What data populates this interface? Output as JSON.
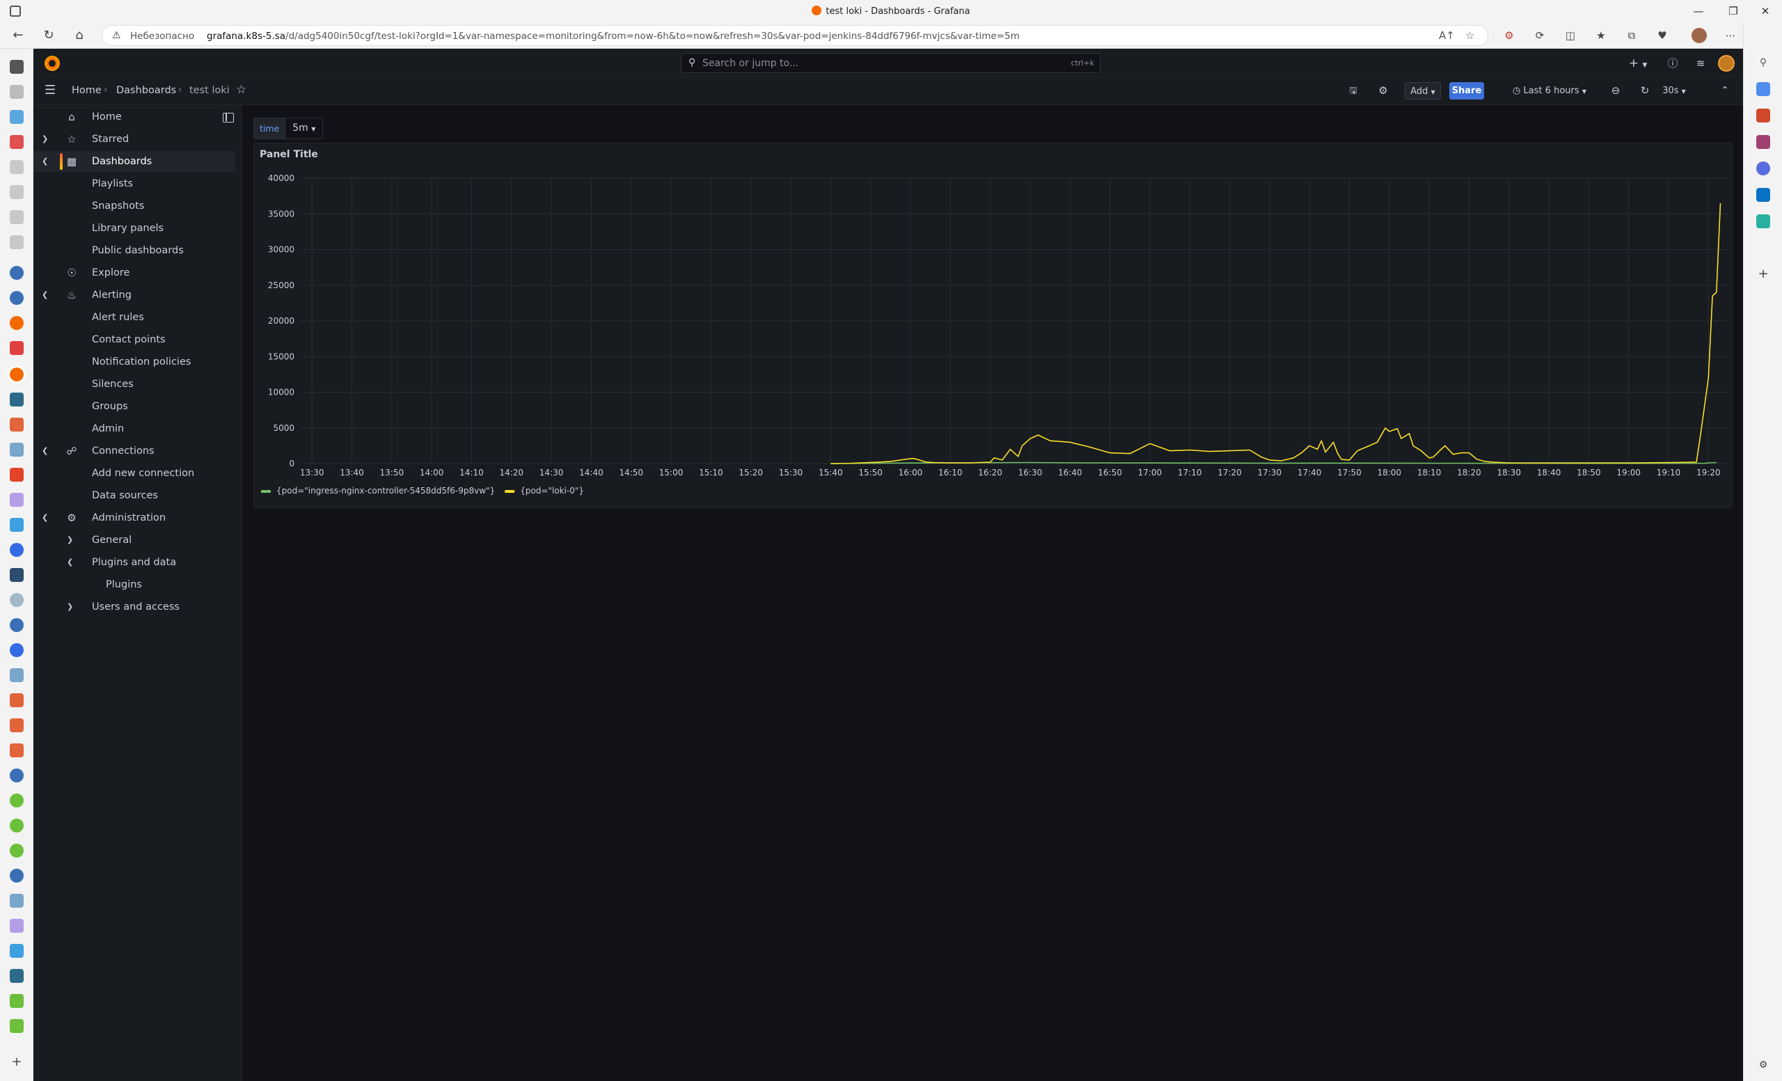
{
  "browser": {
    "window_title": "test loki - Dashboards - Grafana",
    "security_label": "Небезопасно",
    "url_host": "grafana.k8s-5.sa",
    "url_path": "/d/adg5400in50cgf/test-loki?orgId=1&var-namespace=monitoring&from=now-6h&to=now&refresh=30s&var-pod=jenkins-84ddf6796f-mvjcs&var-time=5m"
  },
  "topbar": {
    "search_placeholder": "Search or jump to...",
    "search_shortcut": "ctrl+k",
    "new_label": "+"
  },
  "breadcrumbs": {
    "home": "Home",
    "dashboards": "Dashboards",
    "current": "test loki"
  },
  "controls": {
    "add_label": "Add",
    "share_label": "Share",
    "time_range": "Last 6 hours",
    "refresh_interval": "30s"
  },
  "nav": {
    "home": "Home",
    "starred": "Starred",
    "dashboards": "Dashboards",
    "playlists": "Playlists",
    "snapshots": "Snapshots",
    "library_panels": "Library panels",
    "public_dashboards": "Public dashboards",
    "explore": "Explore",
    "alerting": "Alerting",
    "alert_rules": "Alert rules",
    "contact_points": "Contact points",
    "notification_policies": "Notification policies",
    "silences": "Silences",
    "groups": "Groups",
    "admin": "Admin",
    "connections": "Connections",
    "add_new_connection": "Add new connection",
    "data_sources": "Data sources",
    "administration": "Administration",
    "general": "General",
    "plugins_and_data": "Plugins and data",
    "plugins": "Plugins",
    "users_and_access": "Users and access"
  },
  "variables": {
    "time_label": "time",
    "time_value": "5m"
  },
  "panel": {
    "title": "Panel Title"
  },
  "chart_data": {
    "type": "line",
    "title": "Panel Title",
    "xlabel": "",
    "ylabel": "",
    "ylim": [
      0,
      40000
    ],
    "yticks": [
      0,
      5000,
      10000,
      15000,
      20000,
      25000,
      30000,
      35000,
      40000
    ],
    "xticks": [
      "13:30",
      "13:40",
      "13:50",
      "14:00",
      "14:10",
      "14:20",
      "14:30",
      "14:40",
      "14:50",
      "15:00",
      "15:10",
      "15:20",
      "15:30",
      "15:40",
      "15:50",
      "16:00",
      "16:10",
      "16:20",
      "16:30",
      "16:40",
      "16:50",
      "17:00",
      "17:10",
      "17:20",
      "17:30",
      "17:40",
      "17:50",
      "18:00",
      "18:10",
      "18:20",
      "18:30",
      "18:40",
      "18:50",
      "19:00",
      "19:10",
      "19:20"
    ],
    "xlim": [
      "13:27",
      "19:25"
    ],
    "grid": true,
    "legend_position": "bottom-left",
    "series": [
      {
        "name": "{pod=\"ingress-nginx-controller-5458dd5f6-9p8vw\"}",
        "color": "#73bf69",
        "x": [
          "15:40",
          "16:00",
          "16:30",
          "16:45",
          "17:00",
          "17:30",
          "17:50",
          "18:10",
          "18:30",
          "19:00",
          "19:19",
          "19:20",
          "19:22"
        ],
        "y": [
          0,
          80,
          150,
          100,
          90,
          60,
          70,
          50,
          40,
          30,
          40,
          100,
          150
        ]
      },
      {
        "name": "{pod=\"loki-0\"}",
        "color": "#fade2a",
        "x": [
          "15:40",
          "15:45",
          "15:52",
          "15:55",
          "16:00",
          "16:01",
          "16:04",
          "16:06",
          "16:10",
          "16:15",
          "16:20",
          "16:21",
          "16:23",
          "16:25",
          "16:27",
          "16:28",
          "16:30",
          "16:32",
          "16:35",
          "16:40",
          "16:45",
          "16:50",
          "16:55",
          "17:00",
          "17:05",
          "17:10",
          "17:15",
          "17:20",
          "17:25",
          "17:28",
          "17:30",
          "17:33",
          "17:36",
          "17:38",
          "17:40",
          "17:42",
          "17:43",
          "17:44",
          "17:46",
          "17:47",
          "17:48",
          "17:50",
          "17:52",
          "17:55",
          "17:57",
          "17:59",
          "18:00",
          "18:02",
          "18:03",
          "18:05",
          "18:06",
          "18:08",
          "18:10",
          "18:11",
          "18:13",
          "18:14",
          "18:16",
          "18:18",
          "18:20",
          "18:22",
          "18:24",
          "18:26",
          "18:30",
          "18:40",
          "18:50",
          "19:00",
          "19:10",
          "19:17",
          "19:18",
          "19:19",
          "19:20",
          "19:21",
          "19:22",
          "19:23"
        ],
        "y": [
          0,
          50,
          200,
          300,
          700,
          700,
          200,
          150,
          100,
          100,
          200,
          800,
          500,
          2000,
          1000,
          2500,
          3500,
          4000,
          3200,
          3000,
          2300,
          1500,
          1400,
          2800,
          1800,
          1900,
          1700,
          1800,
          1900,
          900,
          500,
          400,
          800,
          1500,
          2500,
          2000,
          3200,
          1600,
          3000,
          1500,
          600,
          500,
          1800,
          2500,
          3000,
          5000,
          4500,
          4900,
          3500,
          4200,
          2500,
          1800,
          800,
          900,
          2000,
          2500,
          1300,
          1500,
          1500,
          600,
          300,
          200,
          100,
          100,
          100,
          100,
          150,
          200,
          4000,
          8000,
          12000,
          23500,
          24000,
          36500
        ]
      }
    ]
  }
}
